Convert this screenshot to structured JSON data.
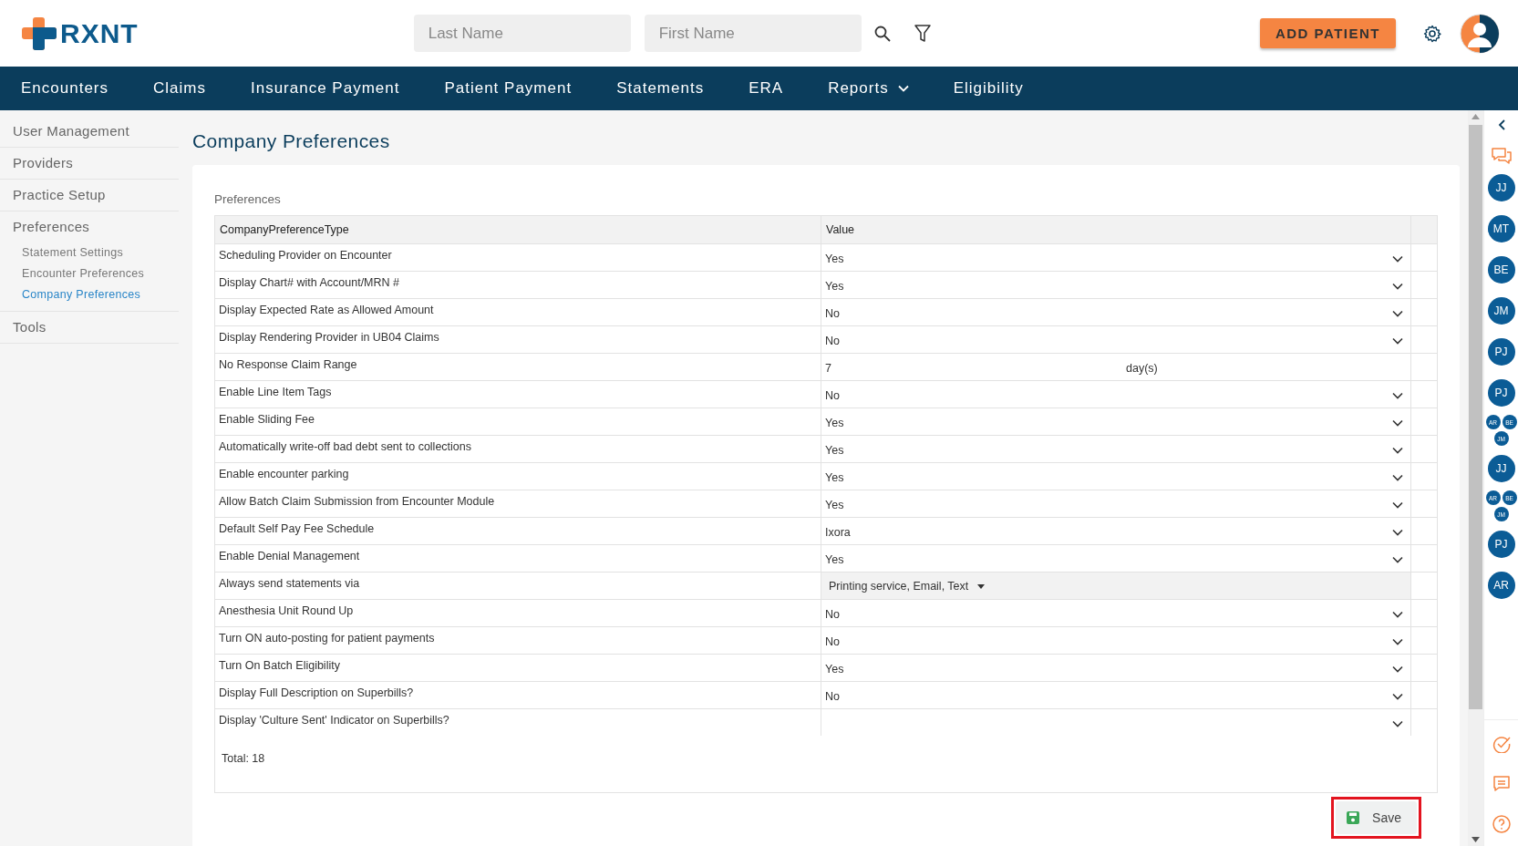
{
  "header": {
    "logo": "RXNT",
    "search_fields": [
      {
        "placeholder": "Last Name"
      },
      {
        "placeholder": "First Name"
      }
    ],
    "add_button": "ADD PATIENT"
  },
  "nav": [
    {
      "label": "Encounters",
      "has_menu": false
    },
    {
      "label": "Claims",
      "has_menu": false
    },
    {
      "label": "Insurance Payment",
      "has_menu": false
    },
    {
      "label": "Patient Payment",
      "has_menu": false
    },
    {
      "label": "Statements",
      "has_menu": false
    },
    {
      "label": "ERA",
      "has_menu": false
    },
    {
      "label": "Reports",
      "has_menu": true
    },
    {
      "label": "Eligibility",
      "has_menu": false
    }
  ],
  "sidebar": {
    "items": [
      {
        "label": "User Management",
        "selected": false
      },
      {
        "label": "Providers",
        "selected": false
      },
      {
        "label": "Practice Setup",
        "selected": false
      },
      {
        "label": "Preferences",
        "selected": false,
        "children": [
          {
            "label": "Statement Settings",
            "selected": false
          },
          {
            "label": "Encounter Preferences",
            "selected": false
          },
          {
            "label": "Company Preferences",
            "selected": true
          }
        ]
      },
      {
        "label": "Tools",
        "selected": false
      }
    ]
  },
  "page_title": "Company Preferences",
  "section_label": "Preferences",
  "table": {
    "columns": [
      "CompanyPreferenceType",
      "Value"
    ],
    "rows": [
      {
        "type": "Scheduling Provider on Encounter",
        "kind": "select",
        "value": "Yes"
      },
      {
        "type": "Display Chart# with Account/MRN #",
        "kind": "select",
        "value": "Yes"
      },
      {
        "type": "Display Expected Rate as Allowed Amount",
        "kind": "select",
        "value": "No"
      },
      {
        "type": "Display Rendering Provider in UB04 Claims",
        "kind": "select",
        "value": "No"
      },
      {
        "type": "No Response Claim Range",
        "kind": "number",
        "value": "7",
        "unit": "day(s)"
      },
      {
        "type": "Enable Line Item Tags",
        "kind": "select",
        "value": "No"
      },
      {
        "type": "Enable Sliding Fee",
        "kind": "select",
        "value": "Yes"
      },
      {
        "type": "Automatically write-off bad debt sent to collections",
        "kind": "select",
        "value": "Yes"
      },
      {
        "type": "Enable encounter parking",
        "kind": "select",
        "value": "Yes"
      },
      {
        "type": "Allow Batch Claim Submission from Encounter Module",
        "kind": "select",
        "value": "Yes"
      },
      {
        "type": "Default Self Pay Fee Schedule",
        "kind": "select",
        "value": "Ixora"
      },
      {
        "type": "Enable Denial Management",
        "kind": "select",
        "value": "Yes"
      },
      {
        "type": "Always send statements via",
        "kind": "multiselect",
        "value": "Printing service,  Email,  Text"
      },
      {
        "type": "Anesthesia Unit Round Up",
        "kind": "select",
        "value": "No"
      },
      {
        "type": "Turn ON auto-posting for patient payments",
        "kind": "select",
        "value": "No"
      },
      {
        "type": "Turn On Batch Eligibility",
        "kind": "select",
        "value": "Yes"
      },
      {
        "type": "Display Full Description on Superbills?",
        "kind": "select",
        "value": "No"
      },
      {
        "type": "Display 'Culture Sent' Indicator on Superbills?",
        "kind": "select"
      }
    ],
    "total": "Total: 18"
  },
  "save_button": "Save",
  "rail": {
    "avatars": [
      {
        "kind": "single",
        "initials": [
          "JJ"
        ]
      },
      {
        "kind": "single",
        "initials": [
          "MT"
        ]
      },
      {
        "kind": "single",
        "initials": [
          "BE"
        ]
      },
      {
        "kind": "single",
        "initials": [
          "JM"
        ]
      },
      {
        "kind": "single",
        "initials": [
          "PJ"
        ]
      },
      {
        "kind": "single",
        "initials": [
          "PJ"
        ]
      },
      {
        "kind": "group",
        "initials": [
          "AR",
          "BE",
          "JM"
        ]
      },
      {
        "kind": "single",
        "initials": [
          "JJ"
        ]
      },
      {
        "kind": "group",
        "initials": [
          "AR",
          "BE",
          "JM"
        ]
      },
      {
        "kind": "single",
        "initials": [
          "PJ"
        ]
      },
      {
        "kind": "single",
        "initials": [
          "AR"
        ]
      }
    ]
  }
}
